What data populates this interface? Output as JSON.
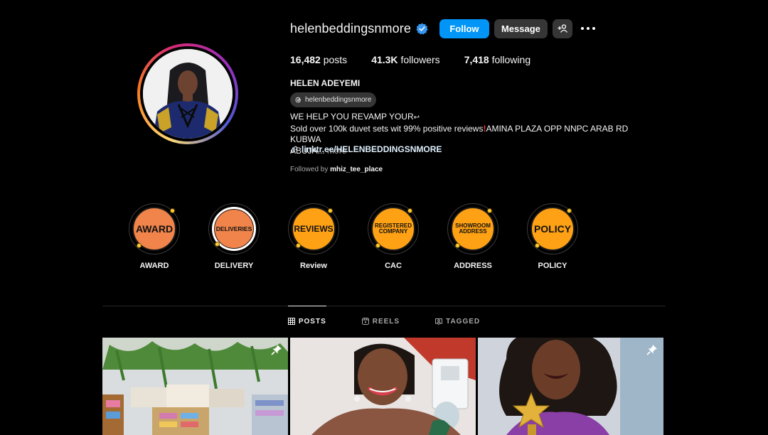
{
  "profile": {
    "username": "helenbeddingsnmore",
    "follow_label": "Follow",
    "message_label": "Message",
    "posts_count": "16,482",
    "posts_label": "posts",
    "followers_count": "41.3K",
    "followers_label": "followers",
    "following_count": "7,418",
    "following_label": "following",
    "full_name": "HELEN ADEYEMI",
    "threads_handle": "helenbeddingsnmore",
    "bio_line1": "WE HELP YOU REVAMP YOUR",
    "bio_line2a": "Sold over 100k duvet sets wit 99% positive reviews",
    "bio_line2b": "AMINA PLAZA OPP NNPC ARAB RD KUBWA",
    "bio_line3": "ABUJA...",
    "more_label": "more",
    "link": "linktr.ee/HELENBEDDINGSNMORE",
    "followed_by_prefix": "Followed by",
    "followed_by_user": "mhiz_tee_place"
  },
  "highlights": [
    {
      "label": "AWARD",
      "cover_text": "AWARD",
      "color": "#f0844a"
    },
    {
      "label": "DELIVERY",
      "cover_text": "DELIVERIES",
      "color": "#f0844a"
    },
    {
      "label": "Review",
      "cover_text": "REVIEWS",
      "color": "#ffa114"
    },
    {
      "label": "CAC",
      "cover_text": "REGISTERED COMPANY",
      "color": "#ffa114"
    },
    {
      "label": "ADDRESS",
      "cover_text": "SHOWROOM ADDRESS",
      "color": "#ffa114"
    },
    {
      "label": "POLICY",
      "cover_text": "POLICY",
      "color": "#ffa114"
    }
  ],
  "tabs": [
    {
      "label": "POSTS",
      "icon": "grid-icon",
      "active": true
    },
    {
      "label": "REELS",
      "icon": "reels-icon",
      "active": false
    },
    {
      "label": "TAGGED",
      "icon": "tagged-icon",
      "active": false
    }
  ],
  "posts": [
    {
      "name": "bedding-store-photo",
      "pinned": true
    },
    {
      "name": "woman-with-award-photo",
      "pinned": false
    },
    {
      "name": "woman-with-star-trophy-photo",
      "pinned": true
    }
  ],
  "colors": {
    "accent": "#0095f6",
    "button_dark": "#363636",
    "verified": "#3897f0"
  }
}
